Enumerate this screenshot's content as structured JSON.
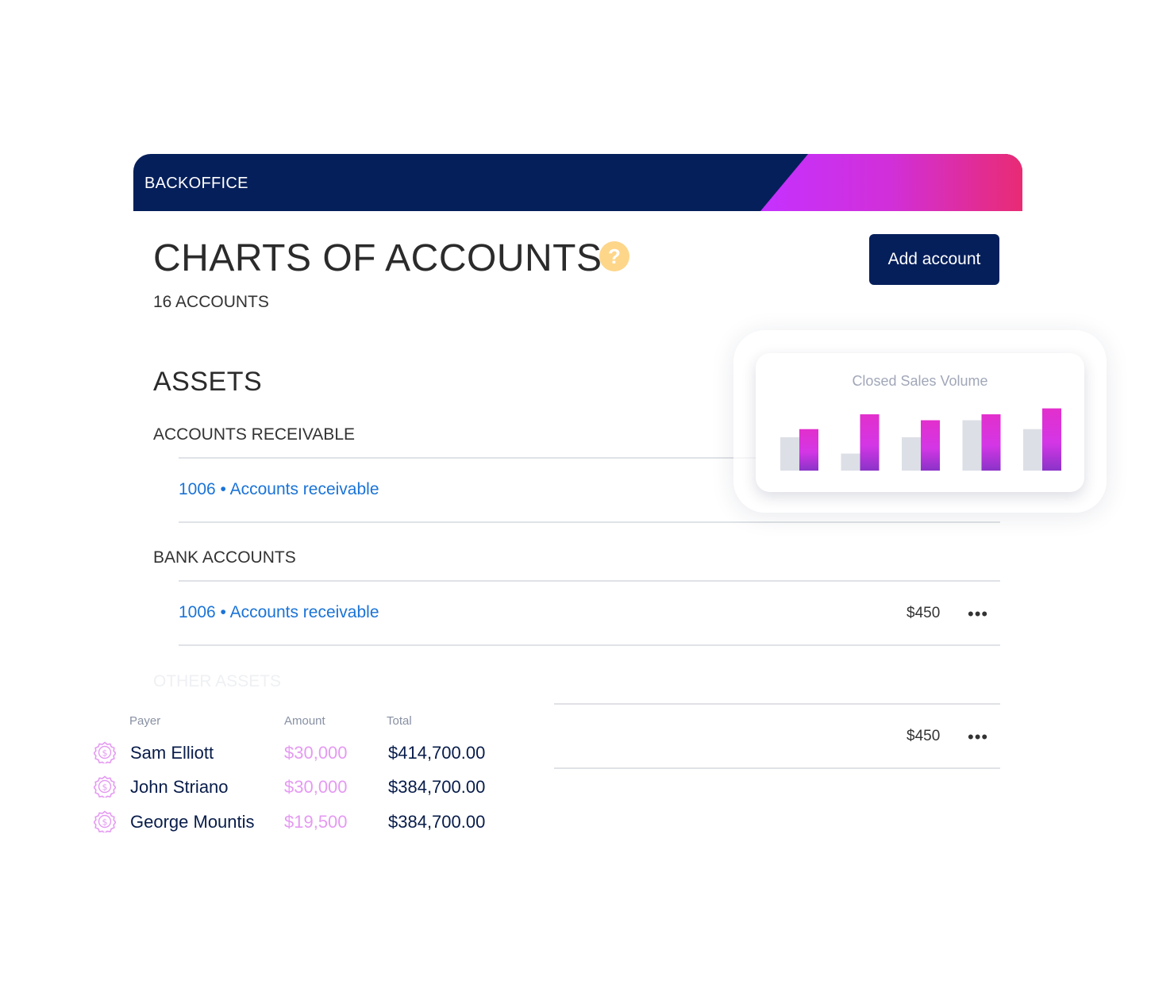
{
  "header": {
    "brand": "BACKOFFICE"
  },
  "page": {
    "title": "CHARTS OF ACCOUNTS",
    "help_icon": "question-icon",
    "count": "16 ACCOUNTS",
    "add_button": "Add account"
  },
  "assets": {
    "title": "ASSETS",
    "groups": [
      {
        "title": "ACCOUNTS RECEIVABLE",
        "rows": [
          {
            "link": "1006 • Accounts receivable"
          }
        ]
      },
      {
        "title": "BANK ACCOUNTS",
        "rows": [
          {
            "link": "1006 • Accounts receivable",
            "amount": "$450",
            "more": "•••"
          }
        ]
      },
      {
        "title": "OTHER ASSETS",
        "rows": [
          {
            "amount": "$450",
            "more": "•••"
          }
        ]
      }
    ]
  },
  "chart_data": {
    "type": "bar",
    "title": "Closed Sales Volume",
    "categories": [
      "",
      "",
      "",
      "",
      ""
    ],
    "series": [
      {
        "values": [
          45,
          23,
          45,
          68,
          56
        ],
        "color": "#dcdfe6"
      },
      {
        "values": [
          56,
          76,
          68,
          76,
          84
        ],
        "color": "#d12fd8"
      }
    ],
    "ylim": [
      0,
      90
    ],
    "grid": false
  },
  "payers": {
    "headers": {
      "payer": "Payer",
      "amount": "Amount",
      "total": "Total"
    },
    "icon": "dollar-coin-icon",
    "accent": "#e59af2",
    "rows": [
      {
        "name": "Sam Elliott",
        "amount": "$30,000",
        "total": "$414,700.00"
      },
      {
        "name": "John Striano",
        "amount": "$30,000",
        "total": "$384,700.00"
      },
      {
        "name": "George Mountis",
        "amount": "$19,500",
        "total": "$384,700.00"
      }
    ]
  }
}
